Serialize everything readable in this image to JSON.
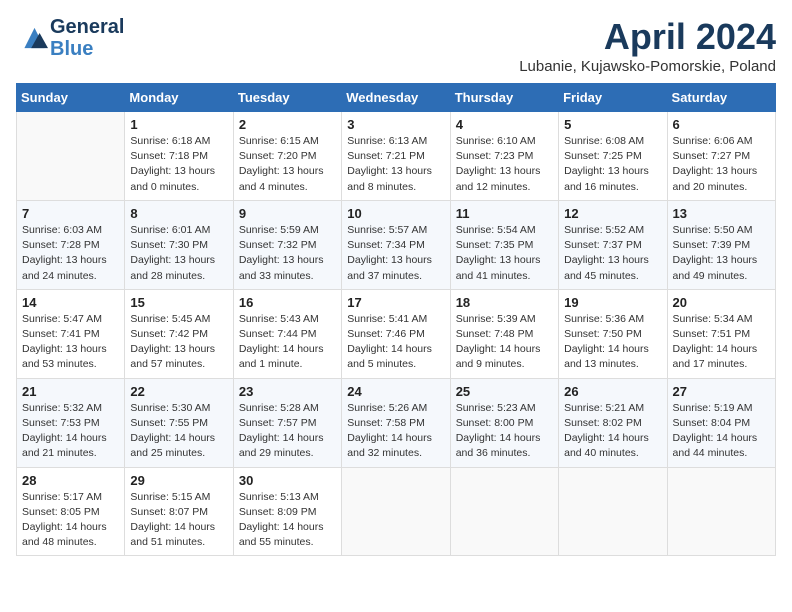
{
  "header": {
    "logo_line1": "General",
    "logo_line2": "Blue",
    "month": "April 2024",
    "location": "Lubanie, Kujawsko-Pomorskie, Poland"
  },
  "weekdays": [
    "Sunday",
    "Monday",
    "Tuesday",
    "Wednesday",
    "Thursday",
    "Friday",
    "Saturday"
  ],
  "weeks": [
    [
      {
        "num": "",
        "info": ""
      },
      {
        "num": "1",
        "info": "Sunrise: 6:18 AM\nSunset: 7:18 PM\nDaylight: 13 hours\nand 0 minutes."
      },
      {
        "num": "2",
        "info": "Sunrise: 6:15 AM\nSunset: 7:20 PM\nDaylight: 13 hours\nand 4 minutes."
      },
      {
        "num": "3",
        "info": "Sunrise: 6:13 AM\nSunset: 7:21 PM\nDaylight: 13 hours\nand 8 minutes."
      },
      {
        "num": "4",
        "info": "Sunrise: 6:10 AM\nSunset: 7:23 PM\nDaylight: 13 hours\nand 12 minutes."
      },
      {
        "num": "5",
        "info": "Sunrise: 6:08 AM\nSunset: 7:25 PM\nDaylight: 13 hours\nand 16 minutes."
      },
      {
        "num": "6",
        "info": "Sunrise: 6:06 AM\nSunset: 7:27 PM\nDaylight: 13 hours\nand 20 minutes."
      }
    ],
    [
      {
        "num": "7",
        "info": "Sunrise: 6:03 AM\nSunset: 7:28 PM\nDaylight: 13 hours\nand 24 minutes."
      },
      {
        "num": "8",
        "info": "Sunrise: 6:01 AM\nSunset: 7:30 PM\nDaylight: 13 hours\nand 28 minutes."
      },
      {
        "num": "9",
        "info": "Sunrise: 5:59 AM\nSunset: 7:32 PM\nDaylight: 13 hours\nand 33 minutes."
      },
      {
        "num": "10",
        "info": "Sunrise: 5:57 AM\nSunset: 7:34 PM\nDaylight: 13 hours\nand 37 minutes."
      },
      {
        "num": "11",
        "info": "Sunrise: 5:54 AM\nSunset: 7:35 PM\nDaylight: 13 hours\nand 41 minutes."
      },
      {
        "num": "12",
        "info": "Sunrise: 5:52 AM\nSunset: 7:37 PM\nDaylight: 13 hours\nand 45 minutes."
      },
      {
        "num": "13",
        "info": "Sunrise: 5:50 AM\nSunset: 7:39 PM\nDaylight: 13 hours\nand 49 minutes."
      }
    ],
    [
      {
        "num": "14",
        "info": "Sunrise: 5:47 AM\nSunset: 7:41 PM\nDaylight: 13 hours\nand 53 minutes."
      },
      {
        "num": "15",
        "info": "Sunrise: 5:45 AM\nSunset: 7:42 PM\nDaylight: 13 hours\nand 57 minutes."
      },
      {
        "num": "16",
        "info": "Sunrise: 5:43 AM\nSunset: 7:44 PM\nDaylight: 14 hours\nand 1 minute."
      },
      {
        "num": "17",
        "info": "Sunrise: 5:41 AM\nSunset: 7:46 PM\nDaylight: 14 hours\nand 5 minutes."
      },
      {
        "num": "18",
        "info": "Sunrise: 5:39 AM\nSunset: 7:48 PM\nDaylight: 14 hours\nand 9 minutes."
      },
      {
        "num": "19",
        "info": "Sunrise: 5:36 AM\nSunset: 7:50 PM\nDaylight: 14 hours\nand 13 minutes."
      },
      {
        "num": "20",
        "info": "Sunrise: 5:34 AM\nSunset: 7:51 PM\nDaylight: 14 hours\nand 17 minutes."
      }
    ],
    [
      {
        "num": "21",
        "info": "Sunrise: 5:32 AM\nSunset: 7:53 PM\nDaylight: 14 hours\nand 21 minutes."
      },
      {
        "num": "22",
        "info": "Sunrise: 5:30 AM\nSunset: 7:55 PM\nDaylight: 14 hours\nand 25 minutes."
      },
      {
        "num": "23",
        "info": "Sunrise: 5:28 AM\nSunset: 7:57 PM\nDaylight: 14 hours\nand 29 minutes."
      },
      {
        "num": "24",
        "info": "Sunrise: 5:26 AM\nSunset: 7:58 PM\nDaylight: 14 hours\nand 32 minutes."
      },
      {
        "num": "25",
        "info": "Sunrise: 5:23 AM\nSunset: 8:00 PM\nDaylight: 14 hours\nand 36 minutes."
      },
      {
        "num": "26",
        "info": "Sunrise: 5:21 AM\nSunset: 8:02 PM\nDaylight: 14 hours\nand 40 minutes."
      },
      {
        "num": "27",
        "info": "Sunrise: 5:19 AM\nSunset: 8:04 PM\nDaylight: 14 hours\nand 44 minutes."
      }
    ],
    [
      {
        "num": "28",
        "info": "Sunrise: 5:17 AM\nSunset: 8:05 PM\nDaylight: 14 hours\nand 48 minutes."
      },
      {
        "num": "29",
        "info": "Sunrise: 5:15 AM\nSunset: 8:07 PM\nDaylight: 14 hours\nand 51 minutes."
      },
      {
        "num": "30",
        "info": "Sunrise: 5:13 AM\nSunset: 8:09 PM\nDaylight: 14 hours\nand 55 minutes."
      },
      {
        "num": "",
        "info": ""
      },
      {
        "num": "",
        "info": ""
      },
      {
        "num": "",
        "info": ""
      },
      {
        "num": "",
        "info": ""
      }
    ]
  ]
}
